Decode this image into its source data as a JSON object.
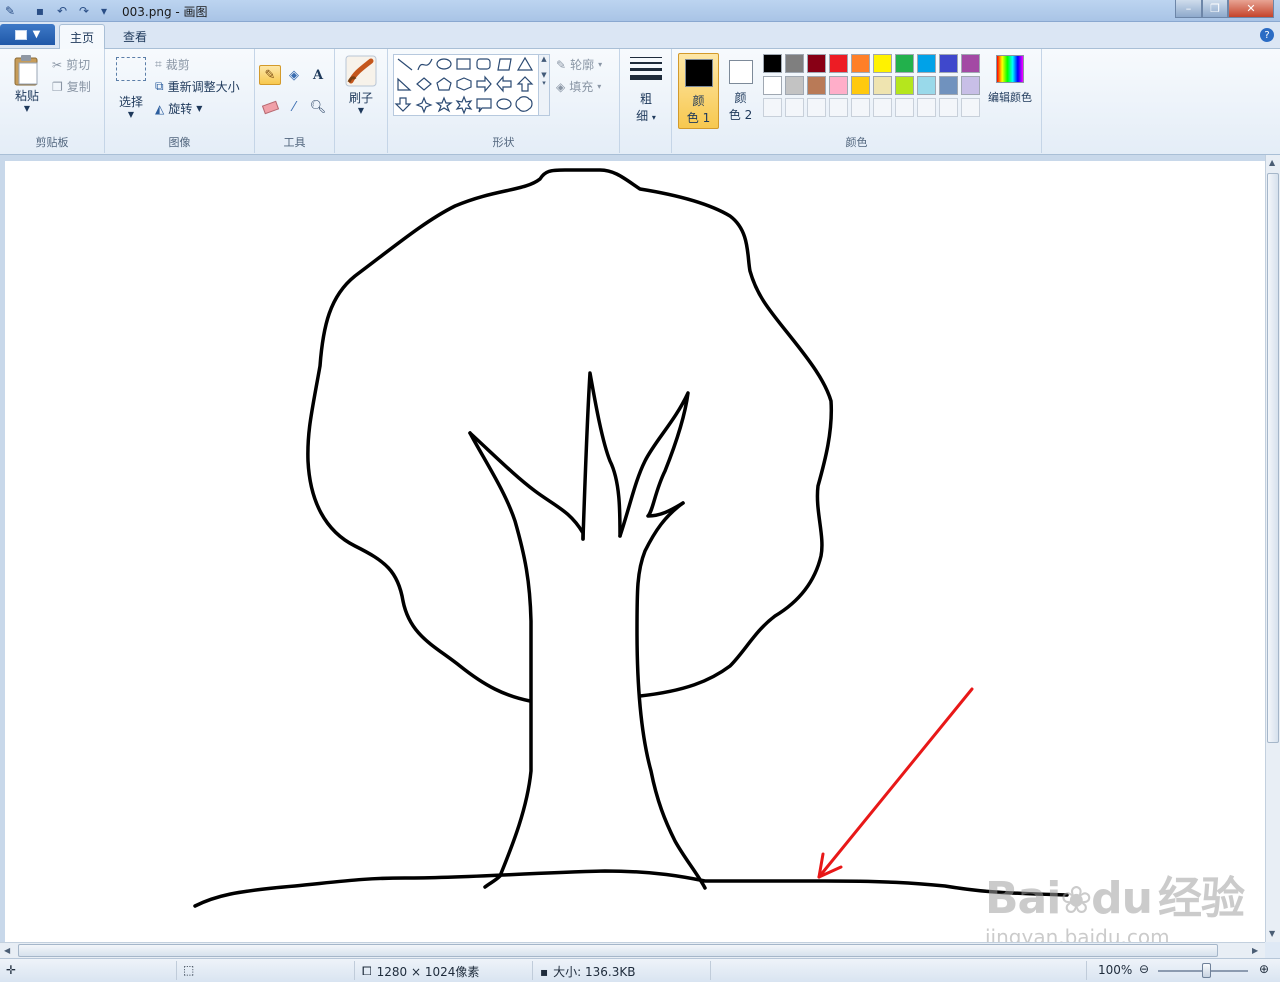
{
  "window": {
    "title": "003.png - 画图",
    "controls": [
      "minimize",
      "maximize",
      "close"
    ]
  },
  "quick_access": [
    "paint-icon",
    "save-icon",
    "undo-icon",
    "redo-icon",
    "customize-icon"
  ],
  "tabs": [
    {
      "label": "主页",
      "active": true
    },
    {
      "label": "查看",
      "active": false
    }
  ],
  "ribbon": {
    "clipboard": {
      "group_label": "剪贴板",
      "paste": "粘贴",
      "cut": "剪切",
      "copy": "复制"
    },
    "image": {
      "group_label": "图像",
      "select": "选择",
      "crop": "裁剪",
      "resize": "重新调整大小",
      "rotate": "旋转"
    },
    "tools": {
      "group_label": "工具",
      "active_tool": "pencil"
    },
    "brushes": {
      "label": "刷子"
    },
    "shapes": {
      "group_label": "形状",
      "outline": "轮廓",
      "fill": "填充"
    },
    "size": {
      "label_top": "粗",
      "label_bottom": "细"
    },
    "colors": {
      "group_label": "颜色",
      "color1_top": "颜",
      "color1_bottom": "色 1",
      "color1_value": "#000000",
      "color2_top": "颜",
      "color2_bottom": "色 2",
      "color2_value": "#ffffff",
      "edit_colors": "编辑颜色",
      "palette_row1": [
        "#000000",
        "#7f7f7f",
        "#880015",
        "#ed1c24",
        "#ff7f27",
        "#fff200",
        "#22b14c",
        "#00a2e8",
        "#3f48cc",
        "#a349a4"
      ],
      "palette_row2": [
        "#ffffff",
        "#c3c3c3",
        "#b97a57",
        "#ffaec9",
        "#ffc90e",
        "#efe4b0",
        "#b5e61d",
        "#99d9ea",
        "#7092be",
        "#c8bfe7"
      ]
    }
  },
  "status": {
    "dimensions": "1280 × 1024像素",
    "size": "大小: 136.3KB",
    "zoom": "100%"
  },
  "colors": {
    "annotation_arrow": "#e81818",
    "stroke": "#000000"
  },
  "watermark": {
    "brand": "Bai",
    "brand2": "du",
    "product": "经验",
    "url": "jingyan.baidu.com"
  }
}
